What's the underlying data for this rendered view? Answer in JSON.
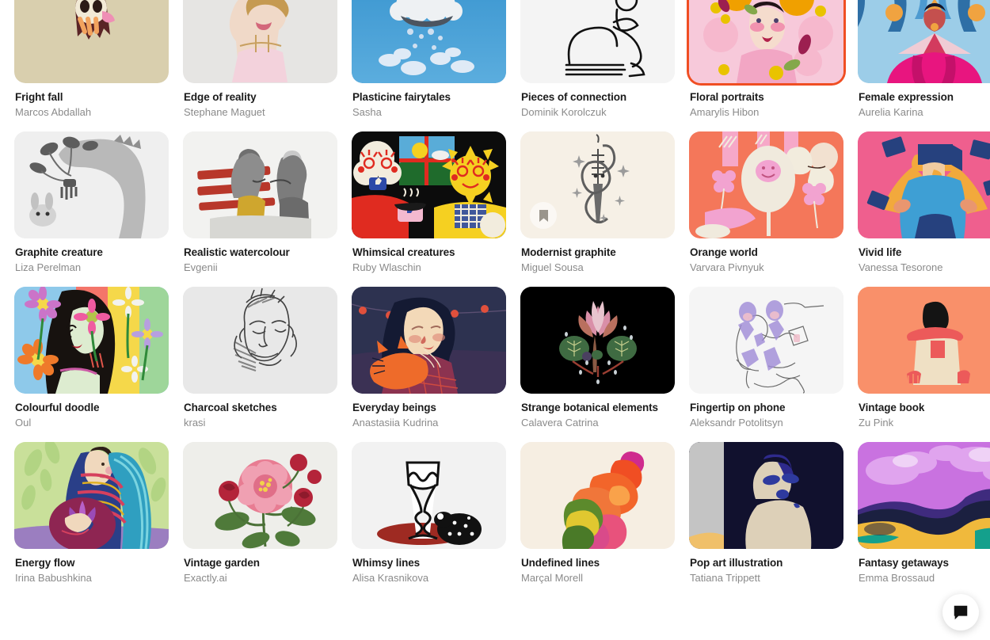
{
  "page": {
    "background": "#ffffff",
    "accent_selected": "#f04e23",
    "title_color": "#1b1b1b",
    "author_color": "#8a8a8a",
    "columns": 6
  },
  "chat": {
    "icon": "chat-bubble-icon",
    "label": ""
  },
  "bookmark": {
    "icon": "bookmark-icon"
  },
  "cards": [
    {
      "title": "Fright fall",
      "author": "Marcos Abdallah",
      "art": "fright-fall",
      "bg": "#d9cfae",
      "selected": false,
      "bookmarked": false
    },
    {
      "title": "Edge of reality",
      "author": "Stephane Maguet",
      "art": "edge-of-reality",
      "bg": "#e6e5e3",
      "selected": false,
      "bookmarked": false
    },
    {
      "title": "Plasticine fairytales",
      "author": "Sasha",
      "art": "plasticine",
      "bg": "#2f87c4",
      "selected": false,
      "bookmarked": false
    },
    {
      "title": "Pieces of connection",
      "author": "Dominik Korolczuk",
      "art": "pieces-connection",
      "bg": "#f4f4f4",
      "selected": false,
      "bookmarked": false
    },
    {
      "title": "Floral portraits",
      "author": "Amarylis Hibon",
      "art": "floral-portraits",
      "bg": "#f6c6d8",
      "selected": true,
      "bookmarked": false
    },
    {
      "title": "Female expression",
      "author": "Aurelia Karina",
      "art": "female-expression",
      "bg": "#8fc6e8",
      "selected": false,
      "bookmarked": false
    },
    {
      "title": "Graphite creature",
      "author": "Liza Perelman",
      "art": "graphite-creature",
      "bg": "#eeeeee",
      "selected": false,
      "bookmarked": false
    },
    {
      "title": "Realistic watercolour",
      "author": "Evgenii",
      "art": "realistic-water",
      "bg": "#f2f2f0",
      "selected": false,
      "bookmarked": false
    },
    {
      "title": "Whimsical creatures",
      "author": "Ruby Wlaschin",
      "art": "whimsical",
      "bg": "#111111",
      "selected": false,
      "bookmarked": false
    },
    {
      "title": "Modernist graphite",
      "author": "Miguel Sousa",
      "art": "modernist-graphite",
      "bg": "#f6f0e6",
      "selected": false,
      "bookmarked": true
    },
    {
      "title": "Orange world",
      "author": "Varvara Pivnyuk",
      "art": "orange-world",
      "bg": "#f4775a",
      "selected": false,
      "bookmarked": false
    },
    {
      "title": "Vivid life",
      "author": "Vanessa Tesorone",
      "art": "vivid-life",
      "bg": "#ef5f8e",
      "selected": false,
      "bookmarked": false
    },
    {
      "title": "Colourful doodle",
      "author": "Oul",
      "art": "colourful-doodle",
      "bg": "#8ec9ea",
      "selected": false,
      "bookmarked": false
    },
    {
      "title": "Charcoal sketches",
      "author": "krasi",
      "art": "charcoal",
      "bg": "#e8e8e8",
      "selected": false,
      "bookmarked": false
    },
    {
      "title": "Everyday beings",
      "author": "Anastasiia Kudrina",
      "art": "everyday-beings",
      "bg": "#2d3250",
      "selected": false,
      "bookmarked": false
    },
    {
      "title": "Strange botanical elements",
      "author": "Calavera Catrina",
      "art": "strange-botanical",
      "bg": "#000000",
      "selected": false,
      "bookmarked": false
    },
    {
      "title": "Fingertip on phone",
      "author": "Aleksandr Potolitsyn",
      "art": "fingertip-phone",
      "bg": "#f5f5f5",
      "selected": false,
      "bookmarked": false
    },
    {
      "title": "Vintage book",
      "author": "Zu Pink",
      "art": "vintage-book",
      "bg": "#f9906a",
      "selected": false,
      "bookmarked": false
    },
    {
      "title": "Energy flow",
      "author": "Irina Babushkina",
      "art": "energy-flow",
      "bg": "#c9e09a",
      "selected": false,
      "bookmarked": false
    },
    {
      "title": "Vintage garden",
      "author": "Exactly.ai",
      "art": "vintage-garden",
      "bg": "#eeeeea",
      "selected": false,
      "bookmarked": false
    },
    {
      "title": "Whimsy lines",
      "author": "Alisa Krasnikova",
      "art": "whimsy-lines",
      "bg": "#f2f2f2",
      "selected": false,
      "bookmarked": false
    },
    {
      "title": "Undefined lines",
      "author": "Marçal Morell",
      "art": "undefined-lines",
      "bg": "#f6eee2",
      "selected": false,
      "bookmarked": false
    },
    {
      "title": "Pop art illustration",
      "author": "Tatiana Trippett",
      "art": "pop-art",
      "bg": "#11112e",
      "selected": false,
      "bookmarked": false
    },
    {
      "title": "Fantasy getaways",
      "author": "Emma Brossaud",
      "art": "fantasy-getaways",
      "bg": "#c972e0",
      "selected": false,
      "bookmarked": false
    }
  ]
}
